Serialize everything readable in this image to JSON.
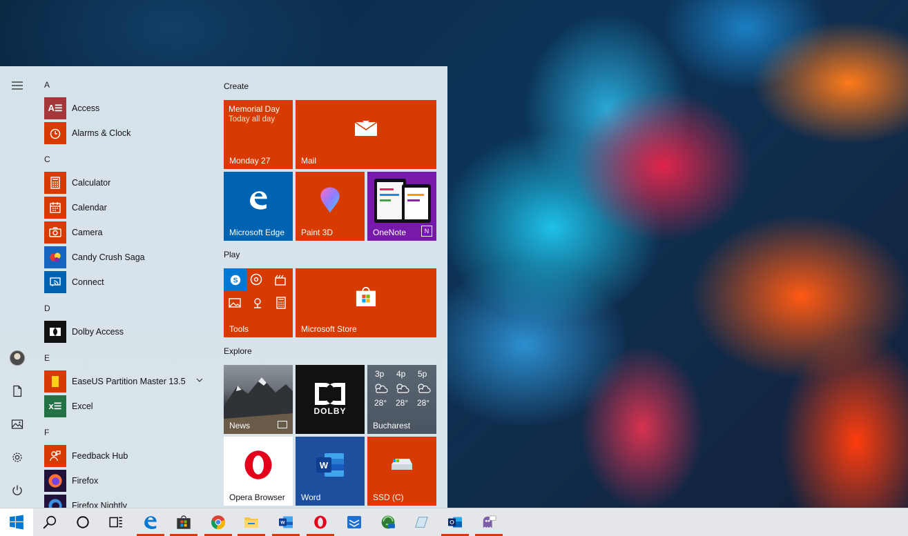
{
  "start_menu": {
    "rail": {
      "menu_icon": "hamburger-icon",
      "user_icon": "user-avatar",
      "documents_icon": "document-icon",
      "pictures_icon": "pictures-icon",
      "settings_icon": "gear-icon",
      "power_icon": "power-icon"
    },
    "app_list": {
      "letters": [
        "A",
        "C",
        "D",
        "E",
        "F"
      ],
      "apps": [
        {
          "label": "Access",
          "color": "#a4373a"
        },
        {
          "label": "Alarms & Clock",
          "color": "#d83b01"
        },
        {
          "label": "Calculator",
          "color": "#d83b01"
        },
        {
          "label": "Calendar",
          "color": "#d83b01"
        },
        {
          "label": "Camera",
          "color": "#d83b01"
        },
        {
          "label": "Candy Crush Saga",
          "color": "#1565c0"
        },
        {
          "label": "Connect",
          "color": "#0063b1"
        },
        {
          "label": "Dolby Access",
          "color": "#111111"
        },
        {
          "label": "EaseUS Partition Master 13.5",
          "color": "#d83b01"
        },
        {
          "label": "Excel",
          "color": "#217346"
        },
        {
          "label": "Feedback Hub",
          "color": "#d83b01"
        },
        {
          "label": "Firefox",
          "color": "#20123a"
        },
        {
          "label": "Firefox Nightly",
          "color": "#20123a"
        }
      ]
    },
    "groups": {
      "create": "Create",
      "play": "Play",
      "explore": "Explore"
    },
    "tiles": {
      "calendar": {
        "title": "Memorial Day",
        "subtitle": "Today all day",
        "date": "Monday 27"
      },
      "mail": "Mail",
      "edge": "Microsoft Edge",
      "paint3d": "Paint 3D",
      "onenote": "OneNote",
      "tools": "Tools",
      "store": "Microsoft Store",
      "news": "News",
      "dolby": "DOLBY",
      "weather": {
        "city": "Bucharest",
        "hours": [
          "3p",
          "4p",
          "5p"
        ],
        "temps": [
          "28°",
          "28°",
          "28°"
        ]
      },
      "opera": "Opera Browser",
      "word": "Word",
      "ssd": "SSD (C)"
    }
  },
  "taskbar": {
    "items": [
      "start-windows-icon",
      "search-icon",
      "cortana-icon",
      "task-view-icon",
      "edge-icon",
      "store-icon",
      "chrome-icon",
      "file-explorer-icon",
      "word-icon",
      "opera-icon",
      "mail-sync-icon",
      "browser-icon",
      "tablet-icon",
      "outlook-icon",
      "chat-app-icon"
    ]
  },
  "colors": {
    "accent": "#d83b01",
    "edge_blue": "#0063b1",
    "onenote_purple": "#7719aa",
    "taskbar": "#e4e6e9"
  }
}
